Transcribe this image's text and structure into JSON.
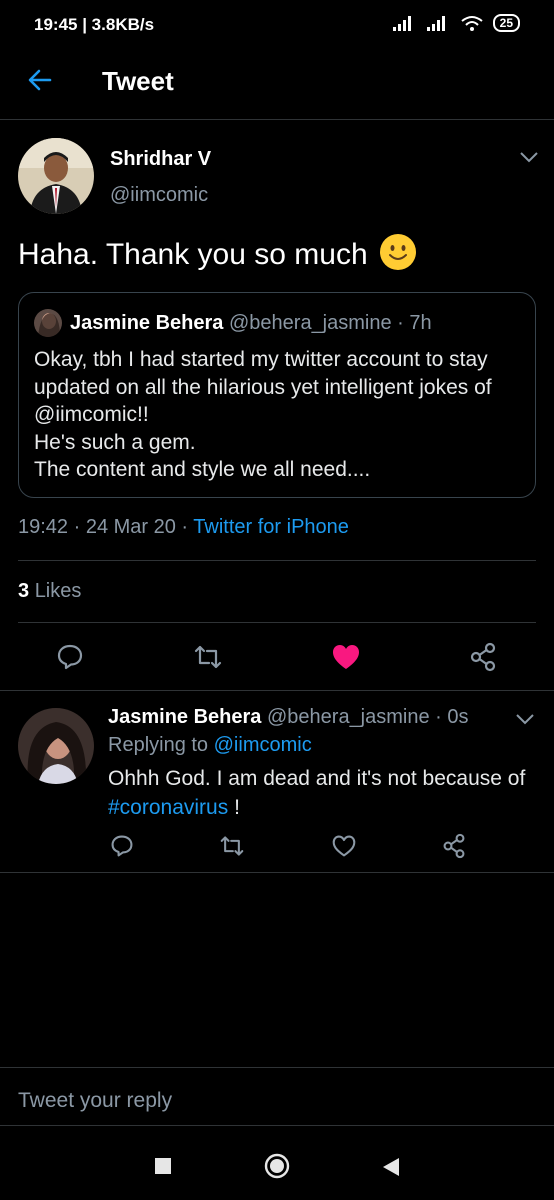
{
  "status_bar": {
    "time": "19:45 | 3.8KB/s",
    "battery": "25"
  },
  "header": {
    "title": "Tweet"
  },
  "tweet": {
    "author_name": "Shridhar V",
    "author_handle": "@iimcomic",
    "text": "Haha. Thank you so much",
    "quote": {
      "author_name": "Jasmine Behera",
      "author_handle": "@behera_jasmine",
      "time_ago": "· 7h",
      "text": "Okay, tbh I had started my twitter account to stay\nupdated on all the hilarious yet intelligent jokes of\n@iimcomic!!\nHe's such a gem.\nThe content and style we all need...."
    },
    "time": "19:42 · 24 Mar 20 ·",
    "source": "Twitter for iPhone",
    "likes_count": "3",
    "likes_label": "Likes",
    "liked_color": "#f91880"
  },
  "reply": {
    "author_name": "Jasmine Behera",
    "author_handle": "@behera_jasmine",
    "time_ago": "· 0s",
    "replying_label": "Replying to",
    "replying_to": "@iimcomic",
    "text": "Ohhh God. I am dead and it's not because of",
    "hashtag": "#coronavirus",
    "trailing": " !"
  },
  "composer": {
    "placeholder": "Tweet your reply"
  },
  "colors": {
    "accent": "#1d9bf0",
    "background": "#000000"
  }
}
